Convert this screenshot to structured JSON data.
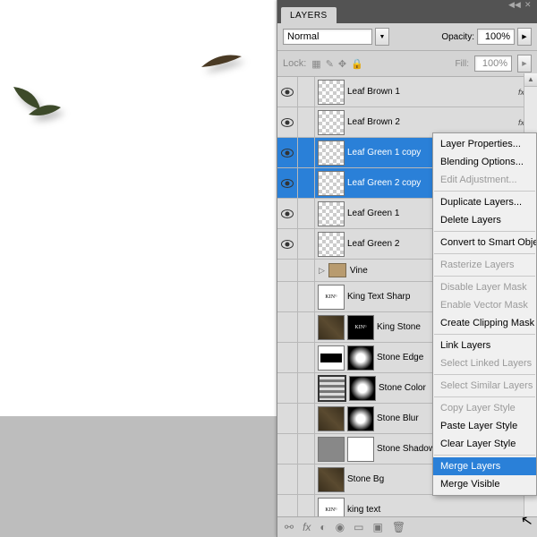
{
  "panel_title": "LAYERS",
  "blend_mode": "Normal",
  "opacity_label": "Opacity:",
  "opacity_value": "100%",
  "lock_label": "Lock:",
  "fill_label": "Fill:",
  "fill_value": "100%",
  "layers": [
    {
      "name": "Leaf Brown 1",
      "vis": true,
      "fx": true,
      "thumb": "checker"
    },
    {
      "name": "Leaf Brown 2",
      "vis": true,
      "fx": true,
      "thumb": "checker"
    },
    {
      "name": "Leaf Green 1 copy",
      "vis": true,
      "sel": true,
      "thumb": "checker"
    },
    {
      "name": "Leaf Green 2 copy",
      "vis": true,
      "sel": true,
      "thumb": "checker"
    },
    {
      "name": "Leaf Green 1",
      "vis": true,
      "thumb": "checker"
    },
    {
      "name": "Leaf Green 2",
      "vis": true,
      "thumb": "checker"
    },
    {
      "name": "Vine",
      "group": true
    },
    {
      "name": "King Text Sharp",
      "thumb": "king-white"
    },
    {
      "name": "King Stone",
      "thumb": "brown",
      "mask": "king"
    },
    {
      "name": "Stone Edge",
      "thumb": "black-bar",
      "mask": "dot"
    },
    {
      "name": "Stone Color",
      "thumb": "bars",
      "mask": "dot"
    },
    {
      "name": "Stone Blur",
      "thumb": "brown",
      "mask": "dot"
    },
    {
      "name": "Stone Shadow",
      "thumb": "gray",
      "mask": "white"
    },
    {
      "name": "Stone Bg",
      "thumb": "brown"
    },
    {
      "name": "king text",
      "thumb": "king-white"
    }
  ],
  "context_menu": [
    {
      "label": "Layer Properties..."
    },
    {
      "label": "Blending Options..."
    },
    {
      "label": "Edit Adjustment...",
      "disabled": true
    },
    {
      "sep": true
    },
    {
      "label": "Duplicate Layers..."
    },
    {
      "label": "Delete Layers"
    },
    {
      "sep": true
    },
    {
      "label": "Convert to Smart Object"
    },
    {
      "sep": true
    },
    {
      "label": "Rasterize Layers",
      "disabled": true
    },
    {
      "sep": true
    },
    {
      "label": "Disable Layer Mask",
      "disabled": true
    },
    {
      "label": "Enable Vector Mask",
      "disabled": true
    },
    {
      "label": "Create Clipping Mask"
    },
    {
      "sep": true
    },
    {
      "label": "Link Layers"
    },
    {
      "label": "Select Linked Layers",
      "disabled": true
    },
    {
      "sep": true
    },
    {
      "label": "Select Similar Layers",
      "disabled": true
    },
    {
      "sep": true
    },
    {
      "label": "Copy Layer Style",
      "disabled": true
    },
    {
      "label": "Paste Layer Style"
    },
    {
      "label": "Clear Layer Style"
    },
    {
      "sep": true
    },
    {
      "label": "Merge Layers",
      "hover": true
    },
    {
      "label": "Merge Visible"
    }
  ]
}
